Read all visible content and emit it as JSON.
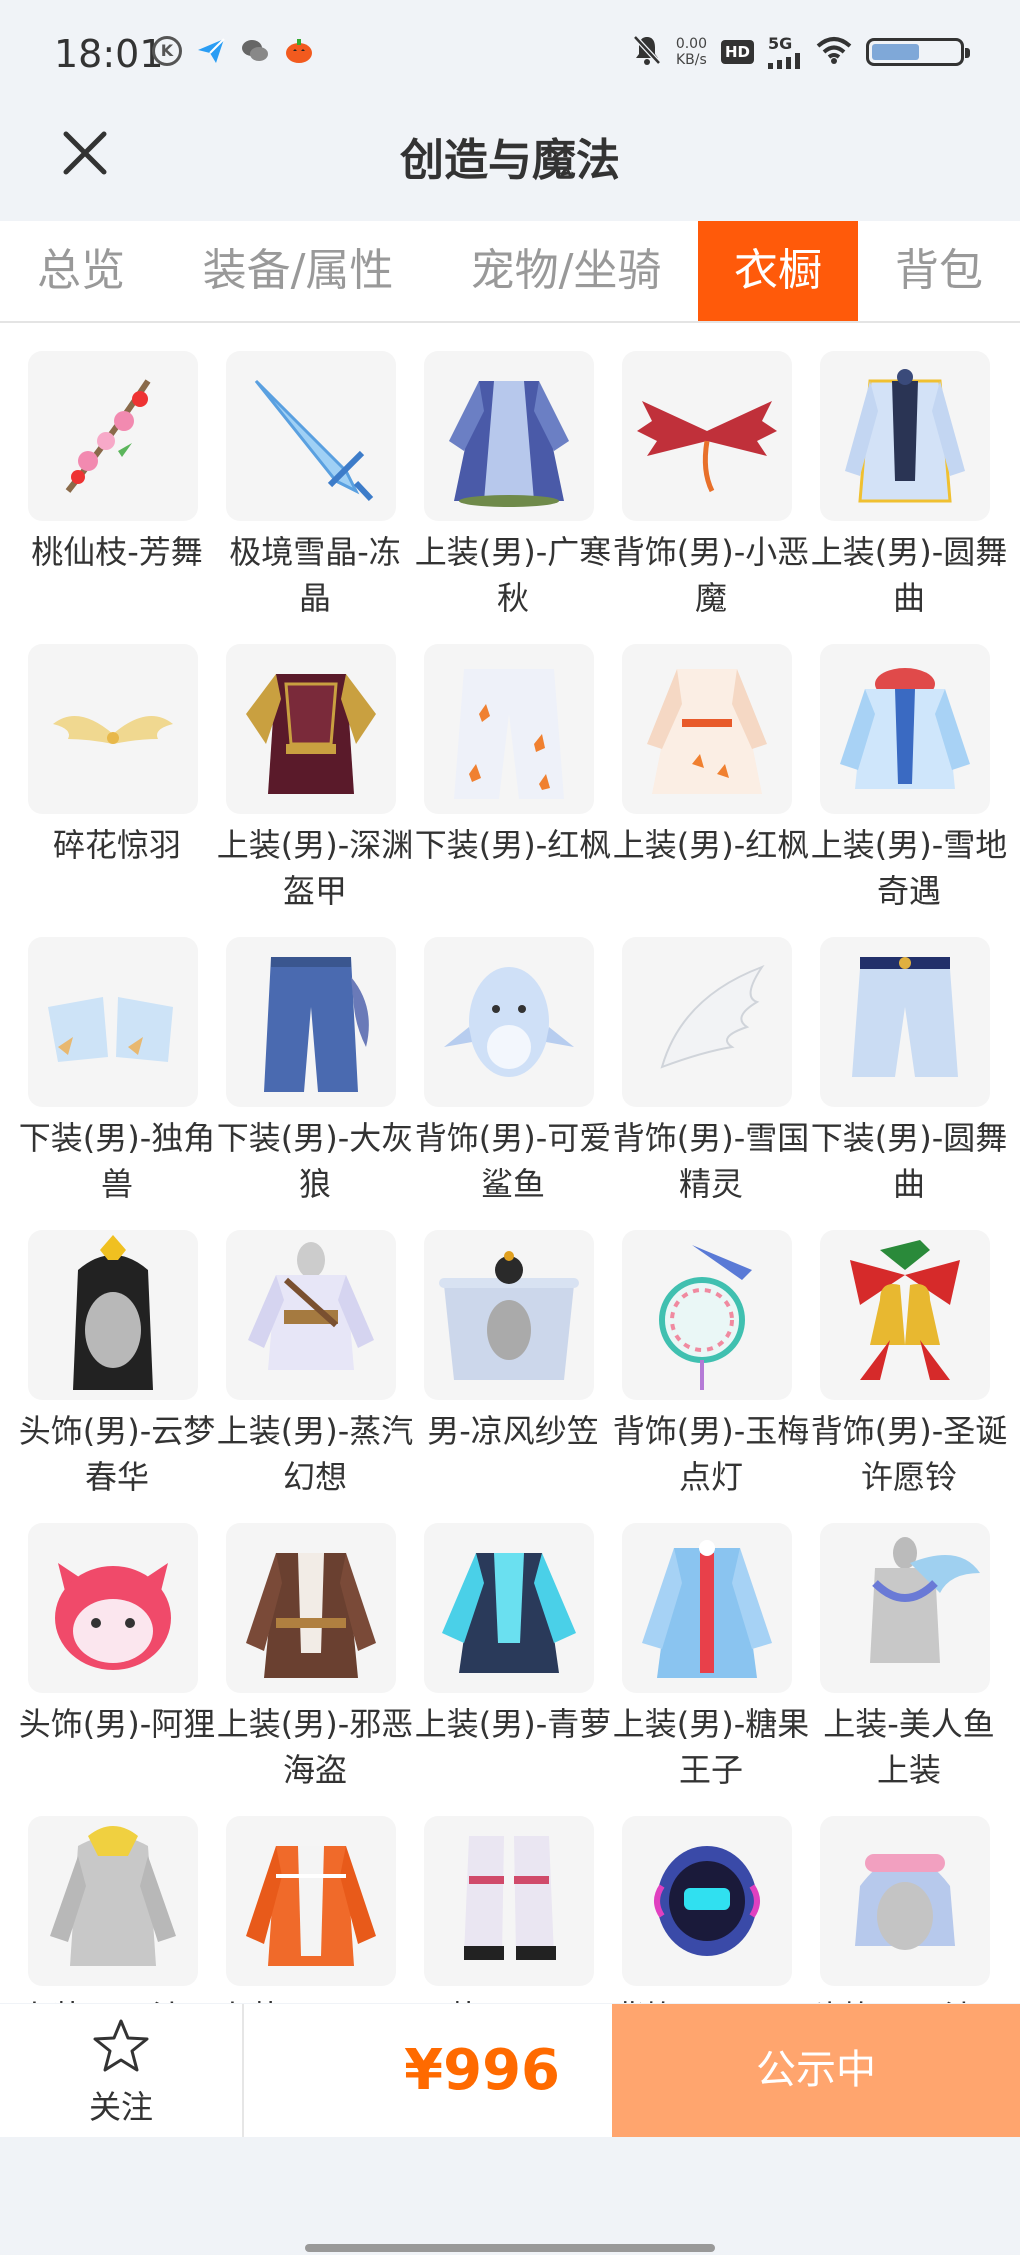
{
  "status_bar": {
    "time": "18:01",
    "net_speed_value": "0.00",
    "net_speed_unit": "KB/s",
    "hd_label": "HD",
    "signal_label": "5G",
    "battery_level": 0.55,
    "notification_icons": [
      "k-circle-icon",
      "paper-plane-icon",
      "wechat-icon",
      "pumpkin-icon"
    ]
  },
  "header": {
    "title": "创造与魔法",
    "close_icon": "close-icon"
  },
  "tabs": [
    {
      "label": "总览",
      "active": false
    },
    {
      "label": "装备/属性",
      "active": false
    },
    {
      "label": "宠物/坐骑",
      "active": false
    },
    {
      "label": "衣橱",
      "active": true
    },
    {
      "label": "背包",
      "active": false
    }
  ],
  "items": [
    {
      "name": "桃仙枝-芳舞",
      "icon": "peach-branch-icon"
    },
    {
      "name": "极境雪晶-冻晶",
      "icon": "ice-sword-icon"
    },
    {
      "name": "上装(男)-广寒秋",
      "icon": "robe-icon"
    },
    {
      "name": "背饰(男)-小恶魔",
      "icon": "devil-wings-icon"
    },
    {
      "name": "上装(男)-圆舞曲",
      "icon": "jacket-icon"
    },
    {
      "name": "碎花惊羽",
      "icon": "golden-wings-icon"
    },
    {
      "name": "上装(男)-深渊盔甲",
      "icon": "armor-icon"
    },
    {
      "name": "下装(男)-红枫",
      "icon": "maple-pants-icon"
    },
    {
      "name": "上装(男)-红枫",
      "icon": "maple-robe-icon"
    },
    {
      "name": "上装(男)-雪地奇遇",
      "icon": "snow-jacket-icon"
    },
    {
      "name": "下装(男)-独角兽",
      "icon": "unicorn-boots-icon"
    },
    {
      "name": "下装(男)-大灰狼",
      "icon": "wolf-pants-icon"
    },
    {
      "name": "背饰(男)-可爱鲨鱼",
      "icon": "shark-icon"
    },
    {
      "name": "背饰(男)-雪国精灵",
      "icon": "white-wing-icon"
    },
    {
      "name": "下装(男)-圆舞曲",
      "icon": "shorts-icon"
    },
    {
      "name": "头饰(男)-云梦春华",
      "icon": "hair-ornament-icon"
    },
    {
      "name": "上装(男)-蒸汽幻想",
      "icon": "steam-jacket-icon"
    },
    {
      "name": "男-凉风纱笠",
      "icon": "veil-hat-icon"
    },
    {
      "name": "背饰(男)-玉梅点灯",
      "icon": "lantern-icon"
    },
    {
      "name": "背饰(男)-圣诞许愿铃",
      "icon": "christmas-bell-icon"
    },
    {
      "name": "头饰(男)-阿狸",
      "icon": "ahri-fox-icon"
    },
    {
      "name": "上装(男)-邪恶海盗",
      "icon": "pirate-coat-icon"
    },
    {
      "name": "上装(男)-青萝",
      "icon": "teal-robe-icon"
    },
    {
      "name": "上装(男)-糖果王子",
      "icon": "candy-prince-icon"
    },
    {
      "name": "上装-美人鱼上装",
      "icon": "mermaid-top-icon"
    },
    {
      "name": "上装(男)-沙...",
      "icon": "hoodie-icon"
    },
    {
      "name": "上装(男)-王...",
      "icon": "orange-jacket-icon"
    },
    {
      "name": "下装(男)-王...",
      "icon": "white-boots-icon"
    },
    {
      "name": "背饰(男)-王...",
      "icon": "robot-pod-icon"
    },
    {
      "name": "头饰(男)-沙...",
      "icon": "goggles-hair-icon"
    }
  ],
  "bottom_bar": {
    "follow_label": "关注",
    "price": "¥996",
    "status_button": "公示中"
  },
  "colors": {
    "accent": "#ff5a0a",
    "price": "#ff6a00",
    "status_button": "#ffa56e",
    "header_bg": "#f0f3f7"
  }
}
